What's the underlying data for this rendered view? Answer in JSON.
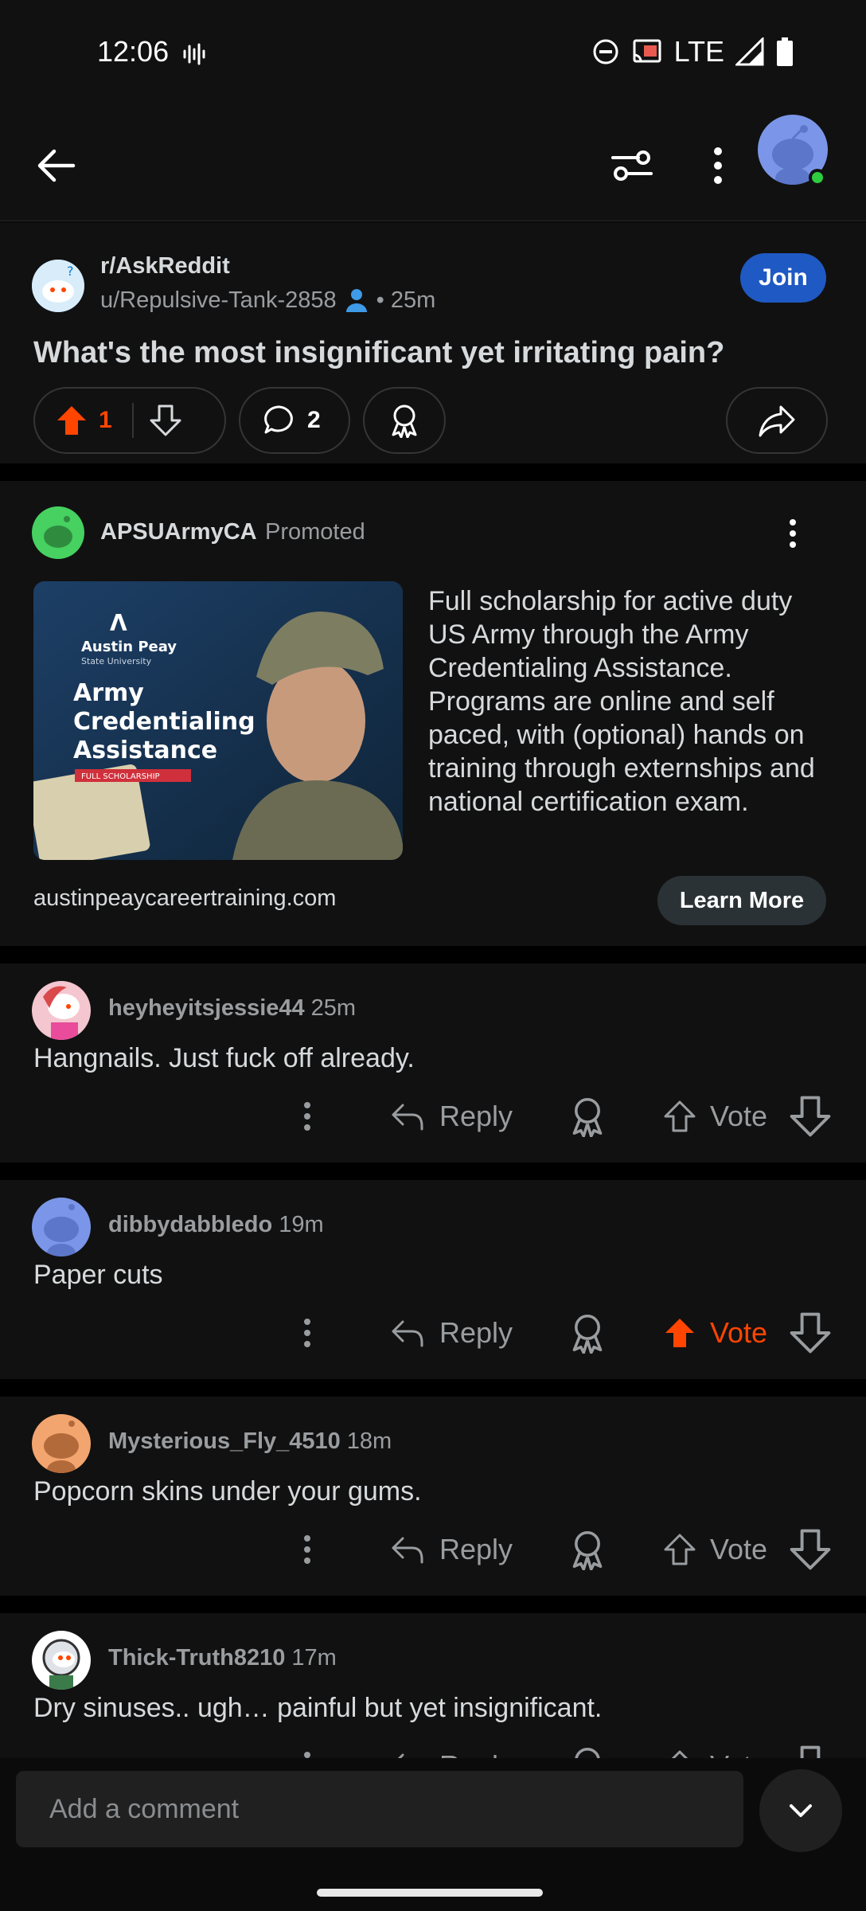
{
  "status_bar": {
    "time": "12:06",
    "network": "LTE"
  },
  "post": {
    "subreddit": "r/AskReddit",
    "author": "u/Repulsive-Tank-2858",
    "age": "• 25m",
    "join_label": "Join",
    "title": "What's the most insignificant yet irritating pain?",
    "upvotes": "1",
    "comments": "2"
  },
  "ad": {
    "name": "APSUArmyCA",
    "promoted": "Promoted",
    "image_lines": {
      "brand": "Austin Peay",
      "brand_sub": "State University",
      "headline_1": "Army",
      "headline_2": "Credentialing",
      "headline_3": "Assistance",
      "tag": "FULL SCHOLARSHIP"
    },
    "text": "Full scholarship for active duty US Army through the Army Credentialing Assistance. Programs are online and self paced, with (optional) hands on training through externships and national certification exam.",
    "domain": "austinpeaycareertraining.com",
    "cta": "Learn More"
  },
  "comments": [
    {
      "user": "heyheyitsjessie44",
      "time": "25m",
      "body": "Hangnails.  Just fuck off already.",
      "reply": "Reply",
      "vote": "Vote",
      "voted": false,
      "avatar_color": "#f4c6d0"
    },
    {
      "user": "dibbydabbledo",
      "time": "19m",
      "body": "Paper cuts",
      "reply": "Reply",
      "vote": "Vote",
      "voted": true,
      "avatar_color": "#7b96e8"
    },
    {
      "user": "Mysterious_Fly_4510",
      "time": "18m",
      "body": "Popcorn skins under your gums.",
      "reply": "Reply",
      "vote": "Vote",
      "voted": false,
      "avatar_color": "#f3a56f"
    },
    {
      "user": "Thick-Truth8210",
      "time": "17m",
      "body": "Dry sinuses.. ugh… painful but yet insignificant.",
      "reply": "Reply",
      "vote": "Vote",
      "voted": false,
      "avatar_color": "#ffffff"
    }
  ],
  "composer": {
    "placeholder": "Add a comment"
  },
  "colors": {
    "accent": "#ff4500",
    "join": "#1f59c3",
    "background": "#111111"
  }
}
